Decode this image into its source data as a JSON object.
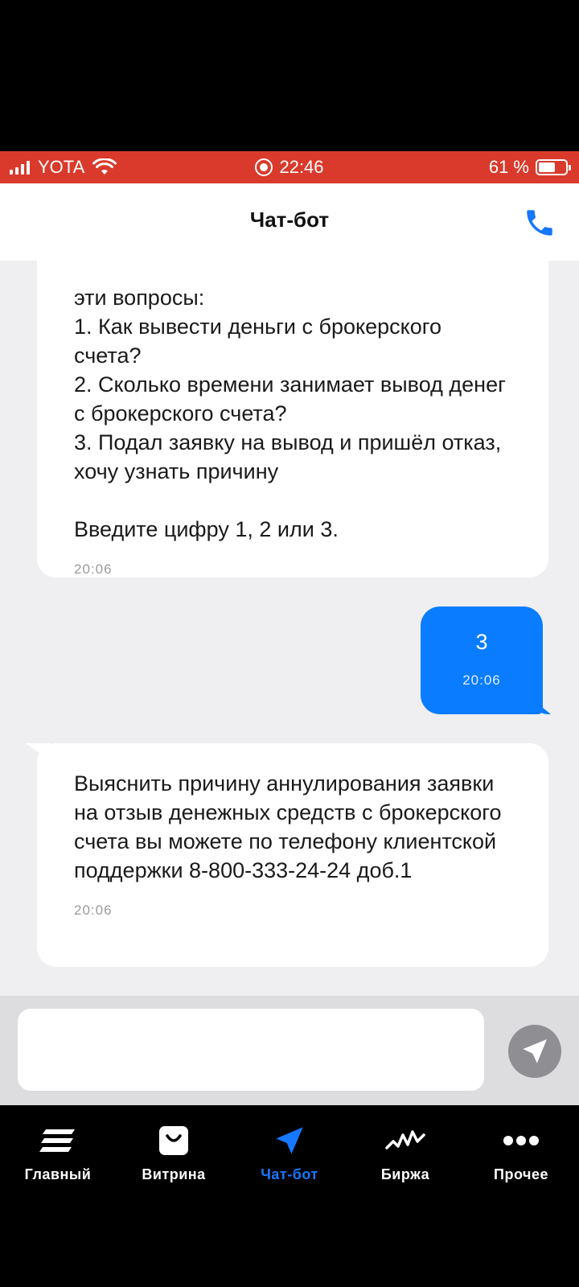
{
  "status_bar": {
    "carrier": "YOTA",
    "time": "22:46",
    "battery": "61 %",
    "battery_level": 0.61
  },
  "header": {
    "title": "Чат-бот"
  },
  "messages": [
    {
      "sender": "bot",
      "text": "эти вопросы:\n1. Как вывести деньги с брокерского счета?\n2. Сколько времени занимает вывод денег с брокерского счета?\n3. Подал заявку на вывод и пришёл отказ, хочу узнать причину\n\nВведите цифру 1, 2 или 3.",
      "time": "20:06"
    },
    {
      "sender": "user",
      "text": "3",
      "time": "20:06"
    },
    {
      "sender": "bot",
      "text": "Выяснить причину аннулирования заявки на отзыв денежных средств с брокерского счета вы можете по телефону клиентской поддержки 8-800-333-24-24 доб.1",
      "time": "20:06"
    }
  ],
  "composer": {
    "placeholder": ""
  },
  "tabs": [
    {
      "label": "Главный",
      "icon": "menu-lines-icon",
      "active": false
    },
    {
      "label": "Витрина",
      "icon": "shopping-bag-icon",
      "active": false
    },
    {
      "label": "Чат-бот",
      "icon": "paper-plane-icon",
      "active": true
    },
    {
      "label": "Биржа",
      "icon": "pulse-chart-icon",
      "active": false
    },
    {
      "label": "Прочее",
      "icon": "more-dots-icon",
      "active": false
    }
  ],
  "colors": {
    "status_bar": "#d93a2b",
    "accent": "#1677ff",
    "user_bubble": "#0a7cff",
    "chat_bg": "#efeff1"
  }
}
